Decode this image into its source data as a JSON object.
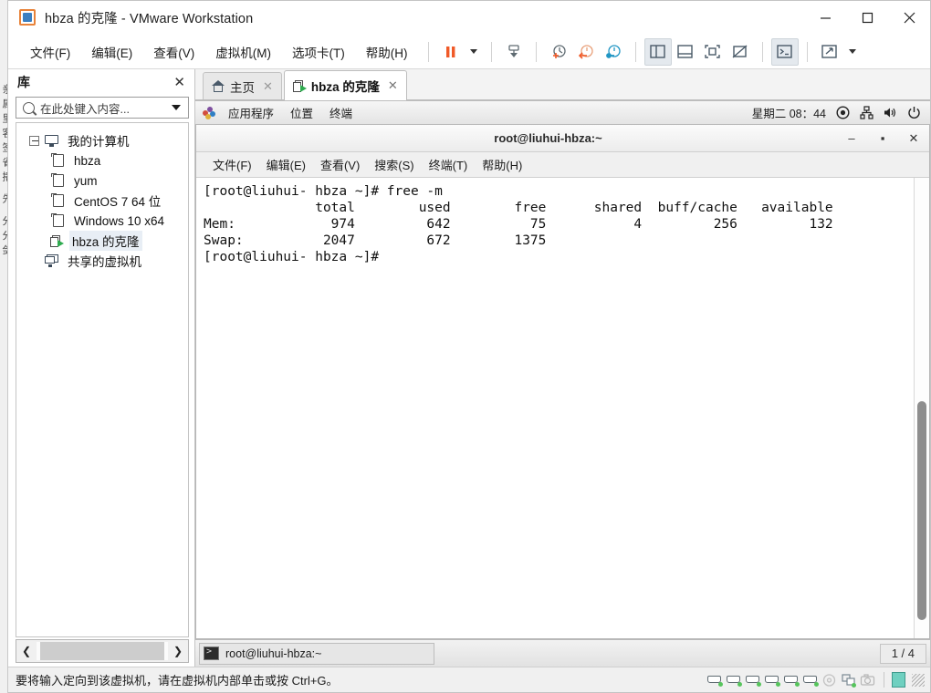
{
  "window": {
    "title": "hbza 的克隆 - VMware Workstation",
    "app_icon": "vmware-icon",
    "minimize": "minimize-icon",
    "maximize": "maximize-icon",
    "close": "close-icon"
  },
  "background_window": {
    "edge_text": "亲属里客签省播   先  分分剑"
  },
  "menubar": [
    {
      "label": "文件(F)",
      "text": "文件",
      "mnemonic": "F"
    },
    {
      "label": "编辑(E)",
      "text": "编辑",
      "mnemonic": "E"
    },
    {
      "label": "查看(V)",
      "text": "查看",
      "mnemonic": "V"
    },
    {
      "label": "虚拟机(M)",
      "text": "虚拟机",
      "mnemonic": "M"
    },
    {
      "label": "选项卡(T)",
      "text": "选项卡",
      "mnemonic": "T"
    },
    {
      "label": "帮助(H)",
      "text": "帮助",
      "mnemonic": "H"
    }
  ],
  "toolbar": {
    "pause_icon": "pause-icon",
    "pause_dropdown": "chevron-down-icon",
    "snapshot_icon": "snapshot-manager-icon",
    "take_snapshot_icon": "take-snapshot-icon",
    "revert_snapshot_icon": "revert-snapshot-icon",
    "manage_snapshot_icon": "manage-snapshot-icon",
    "show_library_icon": "show-library-panel-icon",
    "show_console_icon": "show-console-view-icon",
    "fullscreen_icon": "enter-fullscreen-icon",
    "unity_icon": "unity-mode-icon",
    "console_active_icon": "send-ctrl-alt-del-icon",
    "expand_icon": "stretch-guest-icon",
    "expand_dropdown": "chevron-down-icon"
  },
  "sidebar": {
    "title": "库",
    "close_icon": "close-icon",
    "search": {
      "icon": "search-icon",
      "placeholder": "在此处键入内容...",
      "value": "",
      "dropdown_icon": "chevron-down-icon"
    },
    "tree": [
      {
        "label": "我的计算机",
        "icon": "monitor-icon",
        "level": 0,
        "expanded": true,
        "selected": false
      },
      {
        "label": "hbza",
        "icon": "vm-icon",
        "level": 1,
        "selected": false
      },
      {
        "label": "yum",
        "icon": "vm-icon",
        "level": 1,
        "selected": false
      },
      {
        "label": "CentOS 7 64 位",
        "icon": "vm-icon",
        "level": 1,
        "selected": false
      },
      {
        "label": "Windows 10 x64",
        "icon": "vm-icon",
        "level": 1,
        "selected": false
      },
      {
        "label": "hbza 的克隆",
        "icon": "vm-running-icon",
        "level": 1,
        "selected": true
      },
      {
        "label": "共享的虚拟机",
        "icon": "shared-vms-icon",
        "level": 0,
        "selected": false
      }
    ],
    "hscroll": {
      "left_arrow": "chevron-left-icon",
      "right_arrow": "chevron-right-icon"
    }
  },
  "tabs": [
    {
      "label": "主页",
      "icon": "home-icon",
      "active": false,
      "close_icon": "close-icon"
    },
    {
      "label": "hbza 的克隆",
      "icon": "vm-running-icon",
      "active": true,
      "close_icon": "close-icon"
    }
  ],
  "guest": {
    "panel": {
      "menu_icon": "fedora-logo-icon",
      "items": [
        "应用程序",
        "位置",
        "终端"
      ],
      "clock": "星期二 08：44",
      "indicators": [
        {
          "name": "recording-indicator-icon"
        },
        {
          "name": "network-icon"
        },
        {
          "name": "volume-icon"
        },
        {
          "name": "power-icon"
        }
      ]
    },
    "terminal": {
      "title": "root@liuhui-hbza:~",
      "minimize_icon": "minimize-icon",
      "maximize_icon": "maximize-icon",
      "close_icon": "close-icon",
      "menu": [
        "文件(F)",
        "编辑(E)",
        "查看(V)",
        "搜索(S)",
        "终端(T)",
        "帮助(H)"
      ],
      "lines": [
        "[root@liuhui- hbza ~]# free -m",
        "              total        used        free      shared  buff/cache   available",
        "Mem:            974         642          75           4         256         132",
        "Swap:          2047         672        1375",
        "[root@liuhui- hbza ~]#"
      ],
      "scrollbar": "vertical-scrollbar"
    },
    "taskbar": {
      "item_label": "root@liuhui-hbza:~",
      "item_icon": "terminal-icon",
      "workspace": "1 / 4"
    }
  },
  "statusbar": {
    "message": "要将输入定向到该虚拟机，请在虚拟机内部单击或按 Ctrl+G。",
    "devices": [
      {
        "name": "hard-disk-device-icon"
      },
      {
        "name": "cd-dvd-device-icon"
      },
      {
        "name": "network-adapter-device-icon"
      },
      {
        "name": "usb-device-icon"
      },
      {
        "name": "sound-card-device-icon"
      },
      {
        "name": "printer-device-icon"
      },
      {
        "name": "display-device-icon"
      },
      {
        "name": "shared-folders-device-icon"
      },
      {
        "name": "camera-device-icon"
      }
    ],
    "note_icon": "sticky-note-icon",
    "grip": "resize-grip-icon"
  },
  "colors": {
    "accent_orange": "#e8833a",
    "accent_blue": "#3a7fc1",
    "selection": "#e8eef5",
    "green_status": "#56c45c",
    "teal_note": "#6fd0c0"
  }
}
